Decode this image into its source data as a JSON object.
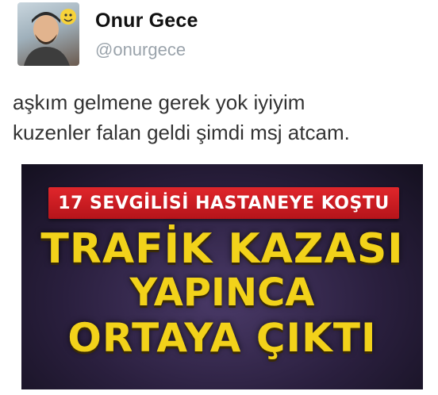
{
  "user": {
    "display_name": "Onur Gece",
    "handle": "@onurgece"
  },
  "tweet": {
    "lines": [
      "aşkım gelmene gerek yok iyiyim",
      "kuzenler falan geldi şimdi msj atcam."
    ]
  },
  "media": {
    "banner": "17 SEVGİLİSİ HASTANEYE KOŞTU",
    "headline_lines": [
      "TRAFİK KAZASI",
      "YAPINCA",
      "ORTAYA ÇIKTI"
    ],
    "colors": {
      "banner_bg": "#d01e24",
      "headline_text": "#f2d21a",
      "background": "#2a1f3e"
    }
  }
}
